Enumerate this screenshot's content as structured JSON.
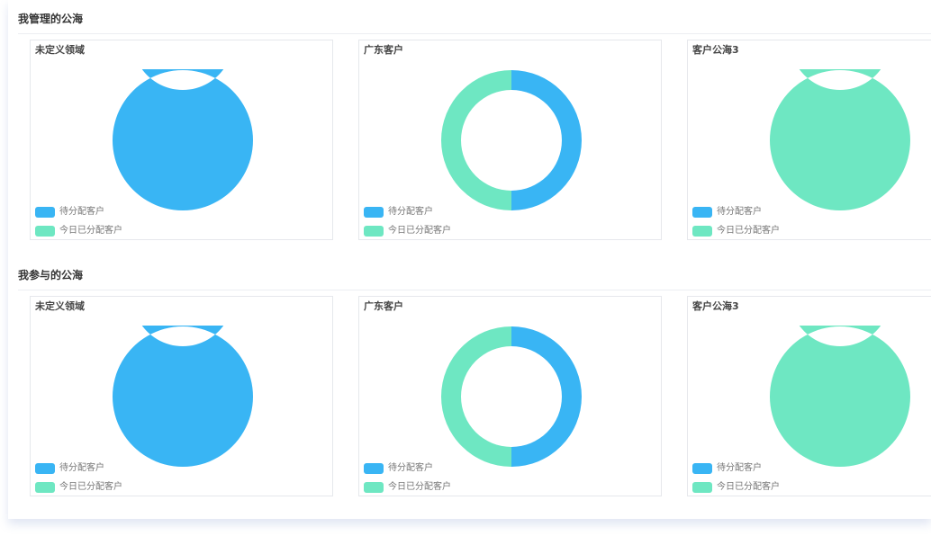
{
  "colors": {
    "pending": "#39b5f4",
    "assigned_today": "#6ee7c2"
  },
  "sections": [
    {
      "title": "我管理的公海",
      "cards": [
        {
          "title": "未定义领域",
          "chart_data": {
            "type": "pie",
            "labels": [
              "待分配客户",
              "今日已分配客户"
            ],
            "values": [
              1,
              0
            ]
          }
        },
        {
          "title": "广东客户",
          "chart_data": {
            "type": "pie",
            "labels": [
              "待分配客户",
              "今日已分配客户"
            ],
            "values": [
              1,
              1
            ]
          }
        },
        {
          "title": "客户公海3",
          "chart_data": {
            "type": "pie",
            "labels": [
              "待分配客户",
              "今日已分配客户"
            ],
            "values": [
              0,
              1
            ]
          }
        }
      ]
    },
    {
      "title": "我参与的公海",
      "cards": [
        {
          "title": "未定义领域",
          "chart_data": {
            "type": "pie",
            "labels": [
              "待分配客户",
              "今日已分配客户"
            ],
            "values": [
              1,
              0
            ]
          }
        },
        {
          "title": "广东客户",
          "chart_data": {
            "type": "pie",
            "labels": [
              "待分配客户",
              "今日已分配客户"
            ],
            "values": [
              1,
              1
            ]
          }
        },
        {
          "title": "客户公海3",
          "chart_data": {
            "type": "pie",
            "labels": [
              "待分配客户",
              "今日已分配客户"
            ],
            "values": [
              0,
              1
            ]
          }
        }
      ]
    }
  ],
  "legend": {
    "pending_label": "待分配客户",
    "assigned_label": "今日已分配客户"
  }
}
